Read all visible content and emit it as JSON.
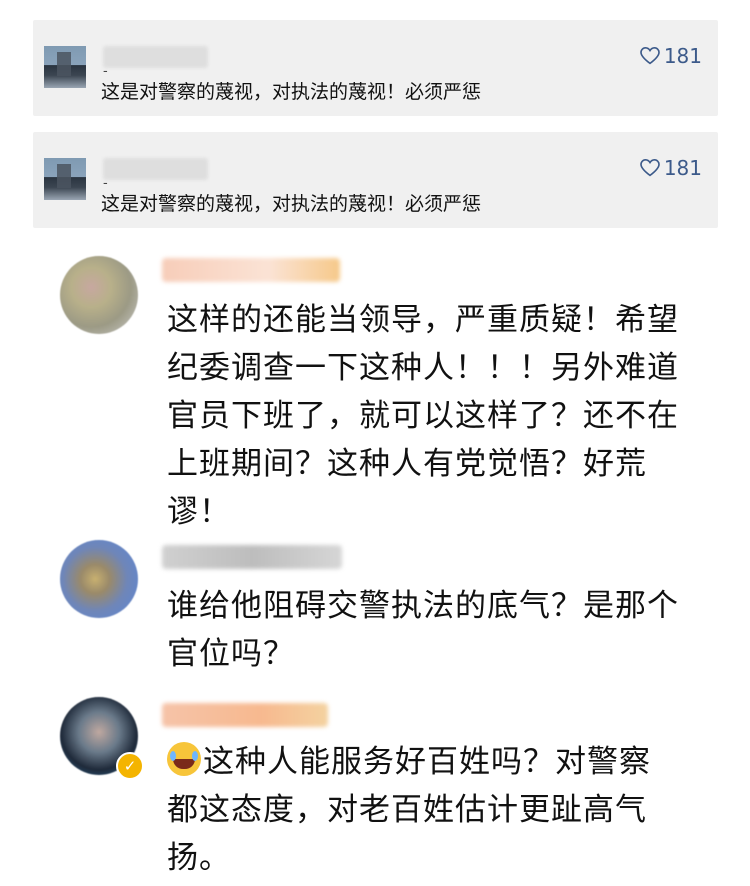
{
  "top_comments": [
    {
      "username": "",
      "text": "这是对警察的蔑视，对执法的蔑视！必须严惩",
      "likes": "181"
    },
    {
      "username": "",
      "text": "这是对警察的蔑视，对执法的蔑视！必须严惩",
      "likes": "181"
    }
  ],
  "comments": [
    {
      "username": "",
      "lines": [
        "这样的还能当领导，严重质疑！希望",
        "纪委调查一下这种人！！！另外难道",
        "官员下班了，就可以这样了？还不在",
        "上班期间？这种人有党觉悟？好荒",
        "谬！"
      ]
    },
    {
      "username": "",
      "lines": [
        "谁给他阻碍交警执法的底气？是那个",
        "官位吗？"
      ]
    },
    {
      "username": "",
      "emoji": "laughing-crying-emoji",
      "lines": [
        "这种人能服务好百姓吗？对警察",
        "都这态度，对老百姓估计更趾高气",
        "扬。"
      ],
      "verified_badge": "✓"
    }
  ],
  "colors": {
    "card_bg": "#f0f0f0",
    "like_color": "#3c5a8a",
    "text": "#111111"
  },
  "icons": {
    "like": "heart-outline-icon"
  }
}
